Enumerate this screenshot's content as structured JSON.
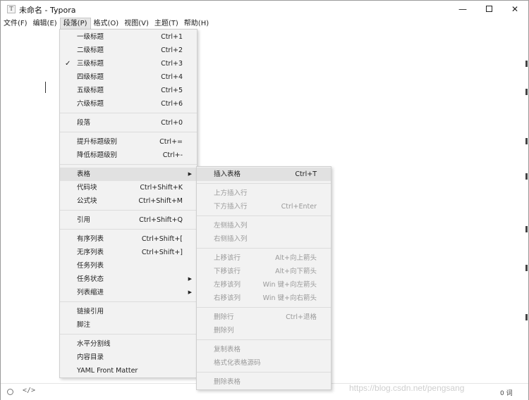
{
  "window": {
    "icon_letter": "T",
    "title": "未命名 - Typora",
    "controls": {
      "minimize": "—",
      "close": "✕"
    }
  },
  "menubar": [
    "文件(F)",
    "编辑(E)",
    "段落(P)",
    "格式(O)",
    "视图(V)",
    "主题(T)",
    "帮助(H)"
  ],
  "paragraph_menu": {
    "headings": [
      {
        "label": "一级标题",
        "shortcut": "Ctrl+1"
      },
      {
        "label": "二级标题",
        "shortcut": "Ctrl+2"
      },
      {
        "label": "三级标题",
        "shortcut": "Ctrl+3",
        "checked": "✓"
      },
      {
        "label": "四级标题",
        "shortcut": "Ctrl+4"
      },
      {
        "label": "五级标题",
        "shortcut": "Ctrl+5"
      },
      {
        "label": "六级标题",
        "shortcut": "Ctrl+6"
      }
    ],
    "paragraph": {
      "label": "段落",
      "shortcut": "Ctrl+0"
    },
    "promote": {
      "label": "提升标题级别",
      "shortcut": "Ctrl+="
    },
    "demote": {
      "label": "降低标题级别",
      "shortcut": "Ctrl+-"
    },
    "table": {
      "label": "表格",
      "arrow": "▶"
    },
    "code_block": {
      "label": "代码块",
      "shortcut": "Ctrl+Shift+K"
    },
    "math_block": {
      "label": "公式块",
      "shortcut": "Ctrl+Shift+M"
    },
    "quote": {
      "label": "引用",
      "shortcut": "Ctrl+Shift+Q"
    },
    "ordered_list": {
      "label": "有序列表",
      "shortcut": "Ctrl+Shift+["
    },
    "unordered_list": {
      "label": "无序列表",
      "shortcut": "Ctrl+Shift+]"
    },
    "task_list": {
      "label": "任务列表"
    },
    "task_status": {
      "label": "任务状态",
      "arrow": "▶"
    },
    "list_indent": {
      "label": "列表缩进",
      "arrow": "▶"
    },
    "link_reference": {
      "label": "链接引用"
    },
    "footnote": {
      "label": "脚注"
    },
    "horizontal_rule": {
      "label": "水平分割线"
    },
    "toc": {
      "label": "内容目录"
    },
    "yaml": {
      "label": "YAML Front Matter"
    }
  },
  "table_menu": {
    "insert_table": {
      "label": "插入表格",
      "shortcut": "Ctrl+T"
    },
    "insert_row_above": {
      "label": "上方插入行"
    },
    "insert_row_below": {
      "label": "下方插入行",
      "shortcut": "Ctrl+Enter"
    },
    "insert_col_left": {
      "label": "左侧插入列"
    },
    "insert_col_right": {
      "label": "右侧插入列"
    },
    "move_row_up": {
      "label": "上移该行",
      "shortcut": "Alt+向上箭头"
    },
    "move_row_down": {
      "label": "下移该行",
      "shortcut": "Alt+向下箭头"
    },
    "move_col_left": {
      "label": "左移该列",
      "shortcut": "Win 键+向左箭头"
    },
    "move_col_right": {
      "label": "右移该列",
      "shortcut": "Win 键+向右箭头"
    },
    "delete_row": {
      "label": "删除行",
      "shortcut": "Ctrl+退格"
    },
    "delete_col": {
      "label": "删除列"
    },
    "copy_table": {
      "label": "复制表格"
    },
    "format_source": {
      "label": "格式化表格源码"
    },
    "delete_table": {
      "label": "删除表格"
    }
  },
  "statusbar": {
    "code_icon": "</>",
    "word_count": "0 词"
  },
  "watermark": "https://blog.csdn.net/pengsang"
}
